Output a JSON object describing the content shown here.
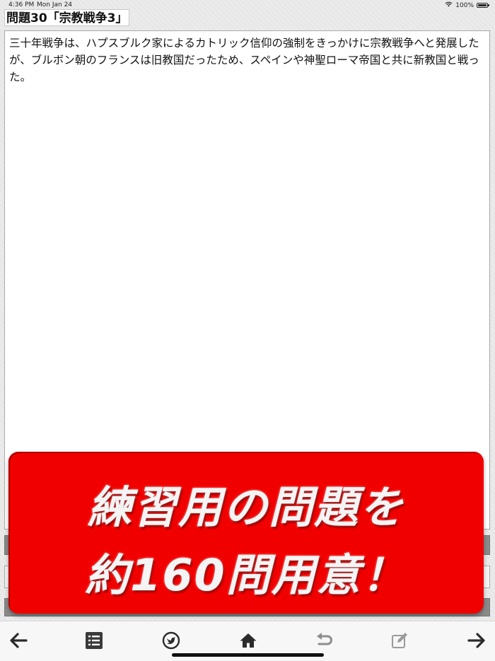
{
  "status_bar": {
    "time": "4:36 PM",
    "date": "Mon Jan 24",
    "battery": "100%"
  },
  "title": "問題30「宗教戦争3」",
  "question": {
    "text": "三十年戦争は、ハプスブルク家によるカトリック信仰の強制をきっかけに宗教戦争へと発展したが、ブルボン朝のフランスは旧教国だったため、スペインや神聖ローマ帝国と共に新教国と戦った。"
  },
  "promo_banner": {
    "line1": "練習用の問題を",
    "line2": "約160問用意！",
    "background": "#f10000"
  },
  "toolbar": {
    "icons": [
      "arrow-left-icon",
      "list-icon",
      "twitter-icon",
      "home-icon",
      "undo-icon",
      "edit-icon",
      "arrow-right-icon"
    ]
  }
}
